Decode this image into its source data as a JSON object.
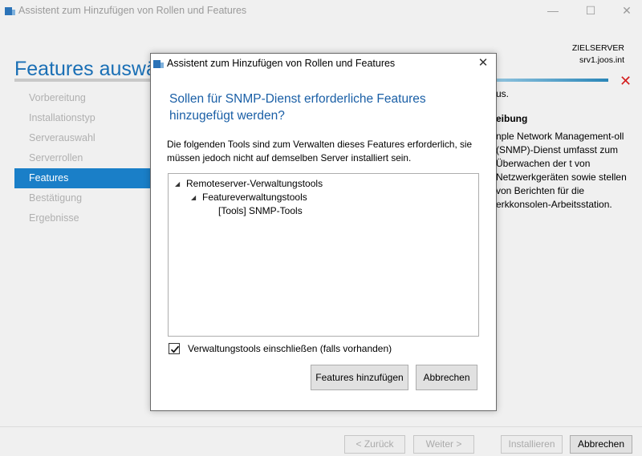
{
  "window": {
    "title": "Assistent zum Hinzufügen von Rollen und Features",
    "minimize_glyph": "—",
    "maximize_glyph": "☐",
    "close_glyph": "✕"
  },
  "header": {
    "page_title": "Features auswählen",
    "target_label": "ZIELSERVER",
    "target_server": "srv1.joos.int"
  },
  "nav": {
    "items": [
      "Vorbereitung",
      "Installationstyp",
      "Serverauswahl",
      "Serverrollen",
      "Features",
      "Bestätigung",
      "Ergebnisse"
    ],
    "active": "Features"
  },
  "description": {
    "line1": "us.",
    "heading": "eibung",
    "body": "nple Network Management-oll (SNMP)-Dienst umfasst zum Überwachen der t von Netzwerkgeräten sowie stellen von Berichten für die erkkonsolen-Arbeitsstation."
  },
  "dialog": {
    "title": "Assistent zum Hinzufügen von Rollen und Features",
    "close_glyph": "✕",
    "heading": "Sollen für SNMP-Dienst erforderliche Features hinzugefügt werden?",
    "text": "Die folgenden Tools sind zum Verwalten dieses Features erforderlich, sie müssen jedoch nicht auf demselben Server installiert sein.",
    "tree": [
      {
        "label": "Remoteserver-Verwaltungstools",
        "level": 0,
        "expanded": true
      },
      {
        "label": "Featureverwaltungstools",
        "level": 1,
        "expanded": true
      },
      {
        "label": "[Tools] SNMP-Tools",
        "level": 2,
        "expanded": false
      }
    ],
    "checkbox_label": "Verwaltungstools einschließen (falls vorhanden)",
    "checkbox_checked": true,
    "add_button": "Features hinzufügen",
    "cancel_button": "Abbrechen"
  },
  "footer": {
    "back": "< Zurück",
    "next": "Weiter >",
    "install": "Installieren",
    "cancel": "Abbrechen"
  },
  "colors": {
    "accent": "#1a7fc8",
    "heading_blue": "#1a5fa6",
    "error_red": "#d42020"
  }
}
